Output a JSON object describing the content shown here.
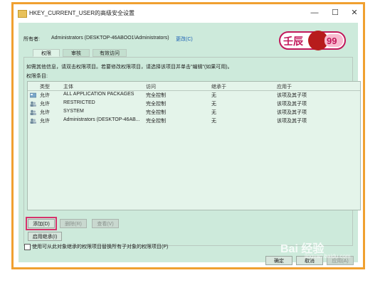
{
  "window": {
    "title": "HKEY_CURRENT_USER的高级安全设置",
    "minimize_icon": "minimize-icon",
    "maximize_icon": "maximize-icon",
    "close_icon": "close-icon"
  },
  "owner": {
    "label": "所有者:",
    "value": "Administrators (DESKTOP-46ABOO1\\Administrators)",
    "change_link": "更改(C)"
  },
  "logo": {
    "text": "壬辰",
    "number": "99"
  },
  "tabs": [
    {
      "label": "权限",
      "active": true
    },
    {
      "label": "审核",
      "active": false
    },
    {
      "label": "有效访问",
      "active": false
    }
  ],
  "info_text": "如需其他信息，请双击权限项目。若要修改权限项目，请选择该项目并单击\"编辑\"(如果可用)。",
  "entries_label": "权限条目:",
  "columns": [
    "类型",
    "主体",
    "访问",
    "继承于",
    "应用于"
  ],
  "rows": [
    {
      "type": "允许",
      "principal": "ALL APPLICATION PACKAGES",
      "access": "完全控制",
      "inherited": "无",
      "applies": "该项及其子项"
    },
    {
      "type": "允许",
      "principal": "RESTRICTED",
      "access": "完全控制",
      "inherited": "无",
      "applies": "该项及其子项"
    },
    {
      "type": "允许",
      "principal": "SYSTEM",
      "access": "完全控制",
      "inherited": "无",
      "applies": "该项及其子项"
    },
    {
      "type": "允许",
      "principal": "Administrators (DESKTOP-46AB...",
      "access": "完全控制",
      "inherited": "无",
      "applies": "该项及其子项"
    }
  ],
  "buttons": {
    "add": "添加(D)",
    "remove": "删除(R)",
    "view": "查看(V)",
    "enable_inheritance": "启用继承(I)",
    "ok": "确定",
    "cancel": "取消",
    "apply": "应用(A)"
  },
  "replace_checkbox": {
    "label": "使用可从此对象继承的权限项目替换所有子对象的权限项目(P)",
    "checked": false
  },
  "watermark": {
    "main": "Bai 经验",
    "sub": "jingyan.baidu.com"
  },
  "colors": {
    "frame": "#f0a030",
    "dialog_bg": "#cdeadb",
    "highlight": "#d6336c",
    "link": "#1a5fb4"
  }
}
